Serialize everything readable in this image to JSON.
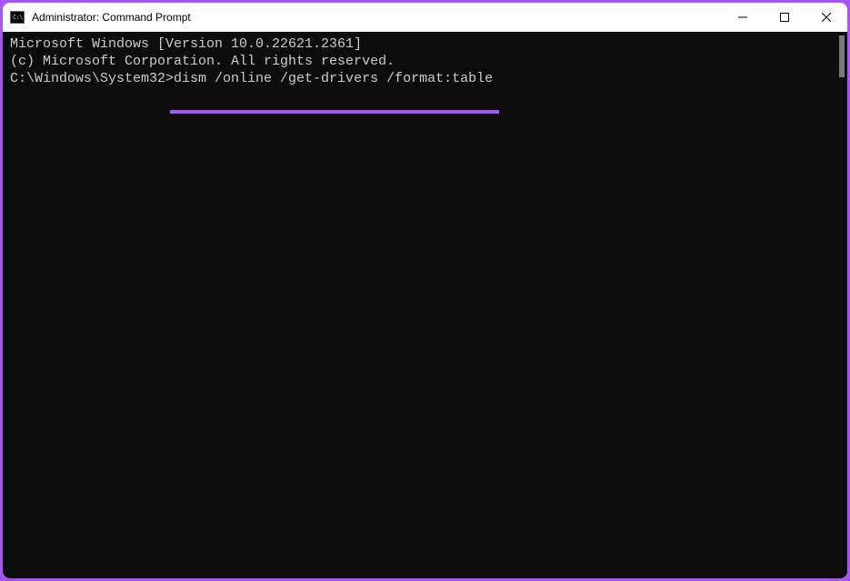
{
  "window": {
    "title": "Administrator: Command Prompt"
  },
  "terminal": {
    "line1": "Microsoft Windows [Version 10.0.22621.2361]",
    "line2": "(c) Microsoft Corporation. All rights reserved.",
    "blank": "",
    "prompt": "C:\\Windows\\System32>",
    "command": "dism /online /get-drivers /format:table"
  },
  "icons": {
    "cmd": "C:\\"
  }
}
